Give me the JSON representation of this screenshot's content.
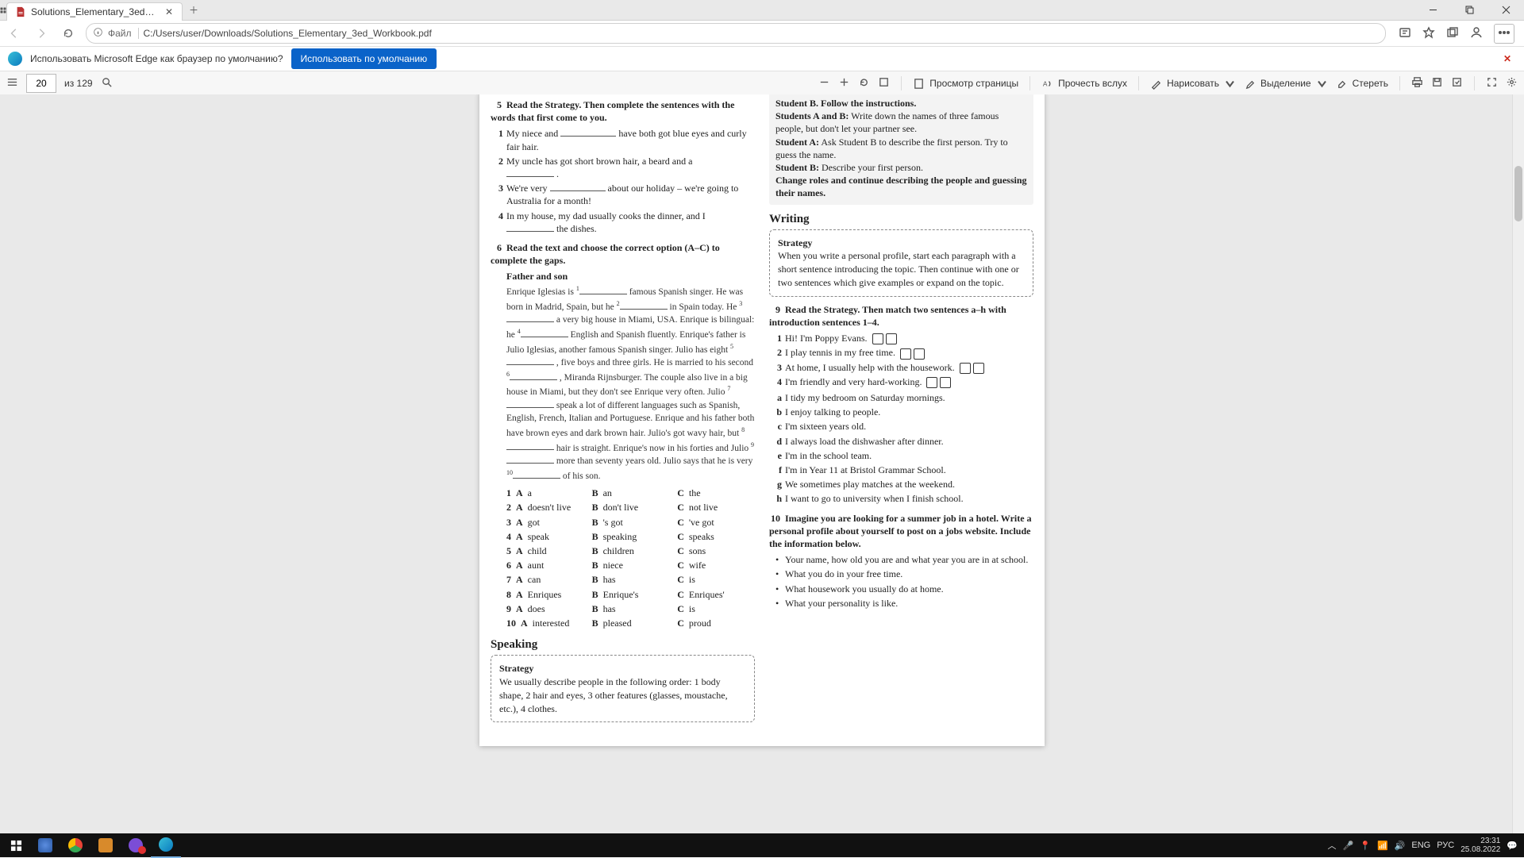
{
  "browser": {
    "tab_title": "Solutions_Elementary_3ed_Work...",
    "url_scheme_label": "Файл",
    "url": "C:/Users/user/Downloads/Solutions_Elementary_3ed_Workbook.pdf",
    "banner_text": "Использовать Microsoft Edge как браузер по умолчанию?",
    "banner_btn": "Использовать по умолчанию"
  },
  "pdf_toolbar": {
    "page_current": "20",
    "page_total_label": "из 129",
    "view_pages": "Просмотр страницы",
    "read_aloud": "Прочесть вслух",
    "draw": "Нарисовать",
    "highlight": "Выделение",
    "erase": "Стереть"
  },
  "doc": {
    "ex5": {
      "num": "5",
      "instr": "Read the Strategy. Then complete the sentences with the words that first come to you.",
      "items": [
        {
          "n": "1",
          "before": "My niece and ",
          "after": " have both got blue eyes and curly fair hair."
        },
        {
          "n": "2",
          "before": "My uncle has got short brown hair, a beard and a ",
          "after": " ."
        },
        {
          "n": "3",
          "before": "We're very ",
          "after": " about our holiday – we're going to Australia for a month!"
        },
        {
          "n": "4",
          "before": "In my house, my dad usually cooks the dinner, and I ",
          "after": " the dishes."
        }
      ]
    },
    "ex6": {
      "num": "6",
      "instr": "Read the text and choose the correct option (A–C) to complete the gaps.",
      "heading": "Father and son",
      "options": [
        {
          "n": "1",
          "A": "a",
          "B": "an",
          "C": "the"
        },
        {
          "n": "2",
          "A": "doesn't live",
          "B": "don't live",
          "C": "not live"
        },
        {
          "n": "3",
          "A": "got",
          "B": "'s got",
          "C": "'ve got"
        },
        {
          "n": "4",
          "A": "speak",
          "B": "speaking",
          "C": "speaks"
        },
        {
          "n": "5",
          "A": "child",
          "B": "children",
          "C": "sons"
        },
        {
          "n": "6",
          "A": "aunt",
          "B": "niece",
          "C": "wife"
        },
        {
          "n": "7",
          "A": "can",
          "B": "has",
          "C": "is"
        },
        {
          "n": "8",
          "A": "Enriques",
          "B": "Enrique's",
          "C": "Enriques'"
        },
        {
          "n": "9",
          "A": "does",
          "B": "has",
          "C": "is"
        },
        {
          "n": "10",
          "A": "interested",
          "B": "pleased",
          "C": "proud"
        }
      ]
    },
    "speaking_title": "Speaking",
    "speaking_strategy_hd": "Strategy",
    "speaking_strategy": "We usually describe people in the following order: 1 body shape, 2 hair and eyes, 3 other features (glasses, moustache, etc.), 4 clothes.",
    "partner": {
      "line0": "Student B. Follow the instructions.",
      "ab_lead": "Students A and B:",
      "ab_text": " Write down the names of three famous people, but don't let your partner see.",
      "a_lead": "Student A:",
      "a_text": " Ask Student B to describe the first person. Try to guess the name.",
      "b_lead": "Student B:",
      "b_text": " Describe your first person.",
      "change": "Change roles and continue describing the people and guessing their names."
    },
    "writing_title": "Writing",
    "writing_strategy_hd": "Strategy",
    "writing_strategy": "When you write a personal profile, start each paragraph with a short sentence introducing the topic. Then continue with one or two sentences which give examples or expand on the topic.",
    "ex9": {
      "num": "9",
      "instr": "Read the Strategy. Then match two sentences a–h with introduction sentences 1–4.",
      "intro": [
        {
          "n": "1",
          "t": "Hi! I'm Poppy Evans."
        },
        {
          "n": "2",
          "t": "I play tennis in my free time."
        },
        {
          "n": "3",
          "t": "At home, I usually help with the housework."
        },
        {
          "n": "4",
          "t": "I'm friendly and very hard-working."
        }
      ],
      "choices": [
        {
          "l": "a",
          "t": "I tidy my bedroom on Saturday mornings."
        },
        {
          "l": "b",
          "t": "I enjoy talking to people."
        },
        {
          "l": "c",
          "t": "I'm sixteen years old."
        },
        {
          "l": "d",
          "t": "I always load the dishwasher after dinner."
        },
        {
          "l": "e",
          "t": "I'm in the school team."
        },
        {
          "l": "f",
          "t": "I'm in Year 11 at Bristol Grammar School."
        },
        {
          "l": "g",
          "t": "We sometimes play matches at the weekend."
        },
        {
          "l": "h",
          "t": "I want to go to university when I finish school."
        }
      ]
    },
    "ex10": {
      "num": "10",
      "instr": "Imagine you are looking for a summer job in a hotel. Write a personal profile about yourself to post on a jobs website. Include the information below.",
      "bullets": [
        "Your name, how old you are and what year you are in at school.",
        "What you do in your free time.",
        "What housework you usually do at home.",
        "What your personality is like."
      ]
    }
  },
  "taskbar": {
    "time": "23:31",
    "date": "25.08.2022",
    "lang1": "ENG",
    "lang2": "РУС"
  }
}
